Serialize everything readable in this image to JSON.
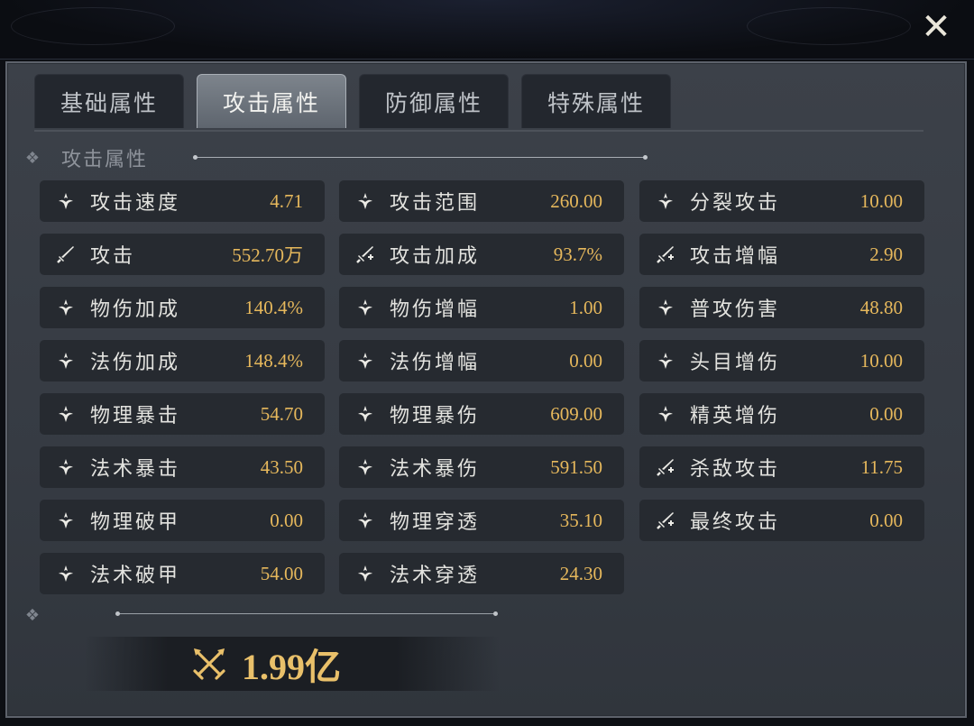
{
  "close_symbol": "✕",
  "tabs": [
    {
      "label": "基础属性",
      "active": false
    },
    {
      "label": "攻击属性",
      "active": true
    },
    {
      "label": "防御属性",
      "active": false
    },
    {
      "label": "特殊属性",
      "active": false
    }
  ],
  "section": {
    "title": "攻击属性",
    "diamond": "❖"
  },
  "columns": [
    [
      {
        "label": "攻击速度",
        "value": "4.71",
        "icon": "fleur-icon"
      },
      {
        "label": "攻击",
        "value": "552.70万",
        "icon": "sword-icon"
      },
      {
        "label": "物伤加成",
        "value": "140.4%",
        "icon": "fleur-icon"
      },
      {
        "label": "法伤加成",
        "value": "148.4%",
        "icon": "fleur-icon"
      },
      {
        "label": "物理暴击",
        "value": "54.70",
        "icon": "fleur-icon"
      },
      {
        "label": "法术暴击",
        "value": "43.50",
        "icon": "fleur-icon"
      },
      {
        "label": "物理破甲",
        "value": "0.00",
        "icon": "fleur-icon"
      },
      {
        "label": "法术破甲",
        "value": "54.00",
        "icon": "fleur-icon"
      }
    ],
    [
      {
        "label": "攻击范围",
        "value": "260.00",
        "icon": "fleur-icon"
      },
      {
        "label": "攻击加成",
        "value": "93.7%",
        "icon": "sword-plus-icon"
      },
      {
        "label": "物伤增幅",
        "value": "1.00",
        "icon": "fleur-icon"
      },
      {
        "label": "法伤增幅",
        "value": "0.00",
        "icon": "fleur-icon"
      },
      {
        "label": "物理暴伤",
        "value": "609.00",
        "icon": "fleur-icon"
      },
      {
        "label": "法术暴伤",
        "value": "591.50",
        "icon": "fleur-icon"
      },
      {
        "label": "物理穿透",
        "value": "35.10",
        "icon": "fleur-icon"
      },
      {
        "label": "法术穿透",
        "value": "24.30",
        "icon": "fleur-icon"
      }
    ],
    [
      {
        "label": "分裂攻击",
        "value": "10.00",
        "icon": "fleur-icon"
      },
      {
        "label": "攻击增幅",
        "value": "2.90",
        "icon": "sword-plus-icon"
      },
      {
        "label": "普攻伤害",
        "value": "48.80",
        "icon": "fleur-icon"
      },
      {
        "label": "头目增伤",
        "value": "10.00",
        "icon": "fleur-icon"
      },
      {
        "label": "精英增伤",
        "value": "0.00",
        "icon": "fleur-icon"
      },
      {
        "label": "杀敌攻击",
        "value": "11.75",
        "icon": "sword-plus-icon"
      },
      {
        "label": "最终攻击",
        "value": "0.00",
        "icon": "sword-plus-icon"
      }
    ]
  ],
  "footer": {
    "diamond": "❖",
    "power_value": "1.99亿",
    "icon": "crossed-swords-icon"
  },
  "colors": {
    "value_gold": "#e6b85c",
    "power_gold": "#e9c06a",
    "panel_bg": "#3a3f47"
  }
}
